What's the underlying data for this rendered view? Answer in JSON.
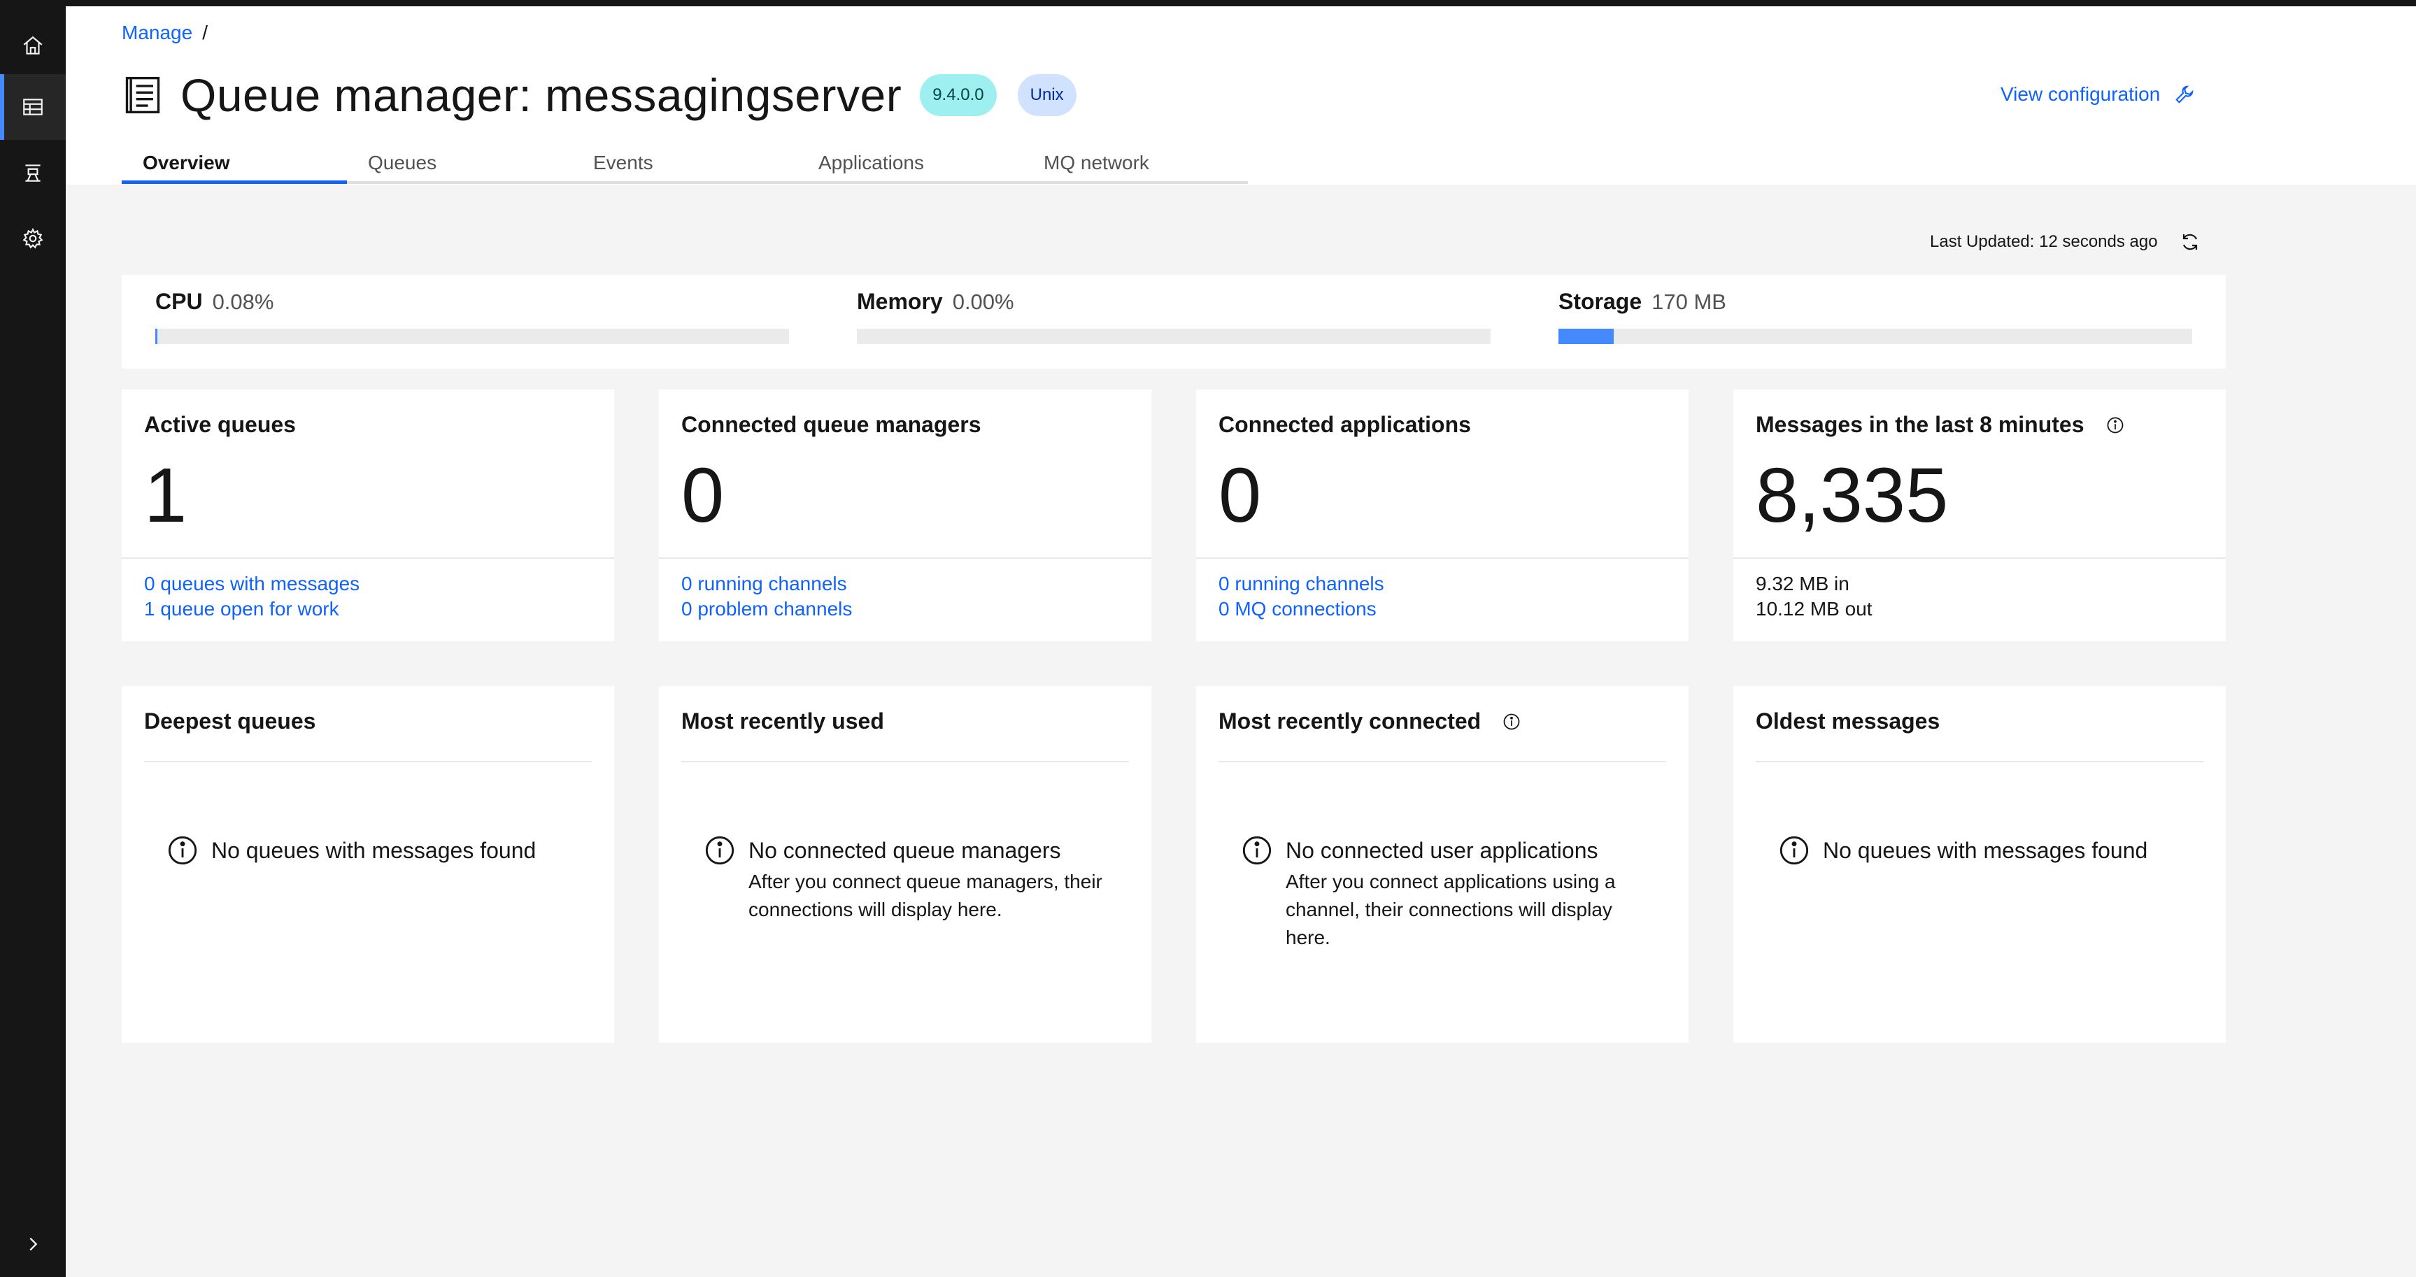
{
  "breadcrumb": {
    "root": "Manage",
    "sep": "/"
  },
  "page": {
    "title": "Queue manager: messagingserver",
    "version_tag": "9.4.0.0",
    "platform_tag": "Unix",
    "view_config": "View configuration"
  },
  "tabs": [
    {
      "label": "Overview",
      "active": true
    },
    {
      "label": "Queues",
      "active": false
    },
    {
      "label": "Events",
      "active": false
    },
    {
      "label": "Applications",
      "active": false
    },
    {
      "label": "MQ network",
      "active": false
    }
  ],
  "last_updated": "Last Updated: 12 seconds ago",
  "resources": {
    "cpu": {
      "label": "CPU",
      "value": "0.08%",
      "fraction": 0.0008
    },
    "memory": {
      "label": "Memory",
      "value": "0.00%",
      "fraction": 0.0
    },
    "storage": {
      "label": "Storage",
      "value": "170 MB",
      "fraction": 0.087
    }
  },
  "cards": {
    "active_queues": {
      "title": "Active queues",
      "count": "1",
      "link1": "0 queues with messages",
      "link2": "1 queue open for work"
    },
    "connected_qms": {
      "title": "Connected queue managers",
      "count": "0",
      "link1": "0 running channels",
      "link2": "0 problem channels"
    },
    "connected_apps": {
      "title": "Connected applications",
      "count": "0",
      "link1": "0 running channels",
      "link2": "0 MQ connections"
    },
    "messages": {
      "title": "Messages in the last 8 minutes",
      "count": "8,335",
      "line1": "9.32 MB in",
      "line2": "10.12 MB out"
    }
  },
  "panels": {
    "deepest": {
      "title": "Deepest queues",
      "empty_title": "No queues with messages found",
      "empty_desc": ""
    },
    "recent_used": {
      "title": "Most recently used",
      "empty_title": "No connected queue managers",
      "empty_desc": "After you connect queue managers, their connections will display here."
    },
    "recent_connected": {
      "title": "Most recently connected",
      "empty_title": "No connected user applications",
      "empty_desc": "After you connect applications using a channel, their connections will display here."
    },
    "oldest": {
      "title": "Oldest messages",
      "empty_title": "No queues with messages found",
      "empty_desc": ""
    }
  },
  "icons": {
    "rail": [
      "home-icon",
      "table-icon",
      "queue-manager-icon",
      "settings-icon",
      "chevron-right-icon"
    ],
    "title": "document-icon",
    "config": "wrench-icon",
    "refresh": "refresh-icon",
    "info": "information-icon"
  },
  "colors": {
    "accent": "#0f62fe",
    "rail_bg": "#161616",
    "version_tag_bg": "#9ef0f0",
    "platform_tag_bg": "#d0e2ff",
    "bar_fill": "#4589ff"
  }
}
